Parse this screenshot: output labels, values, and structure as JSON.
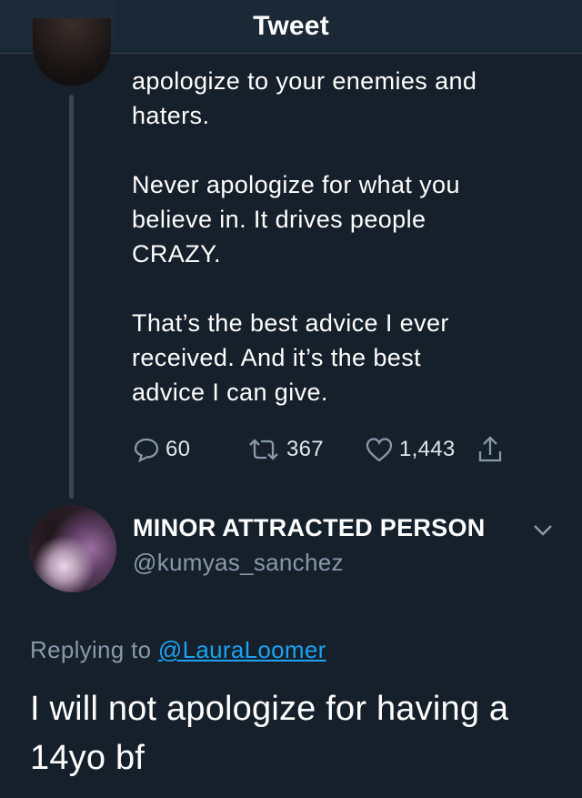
{
  "header": {
    "title": "Tweet"
  },
  "tweet": {
    "paragraphs": [
      "apologize to your enemies and\nhaters.",
      "Never apologize for what you\nbelieve in. It drives people\nCRAZY.",
      "That’s the best advice I ever\nreceived. And it’s the best\nadvice I can give."
    ],
    "stats": {
      "replies": "60",
      "retweets": "367",
      "likes": "1,443"
    }
  },
  "reply": {
    "user_name": "MINOR ATTRACTED PERSON",
    "user_handle": "@kumyas_sanchez",
    "replying_prefix": "Replying to",
    "replying_to": "@LauraLoomer",
    "text": "I will not apologize for having a 14yo bf"
  },
  "icons": {
    "reply": "comment-bubble-icon",
    "retweet": "retweet-icon",
    "like": "heart-icon",
    "share": "share-icon",
    "menu": "chevron-down-icon"
  },
  "colors": {
    "background": "#15202b",
    "secondary_text": "#8899a6",
    "link": "#1da1f2"
  }
}
